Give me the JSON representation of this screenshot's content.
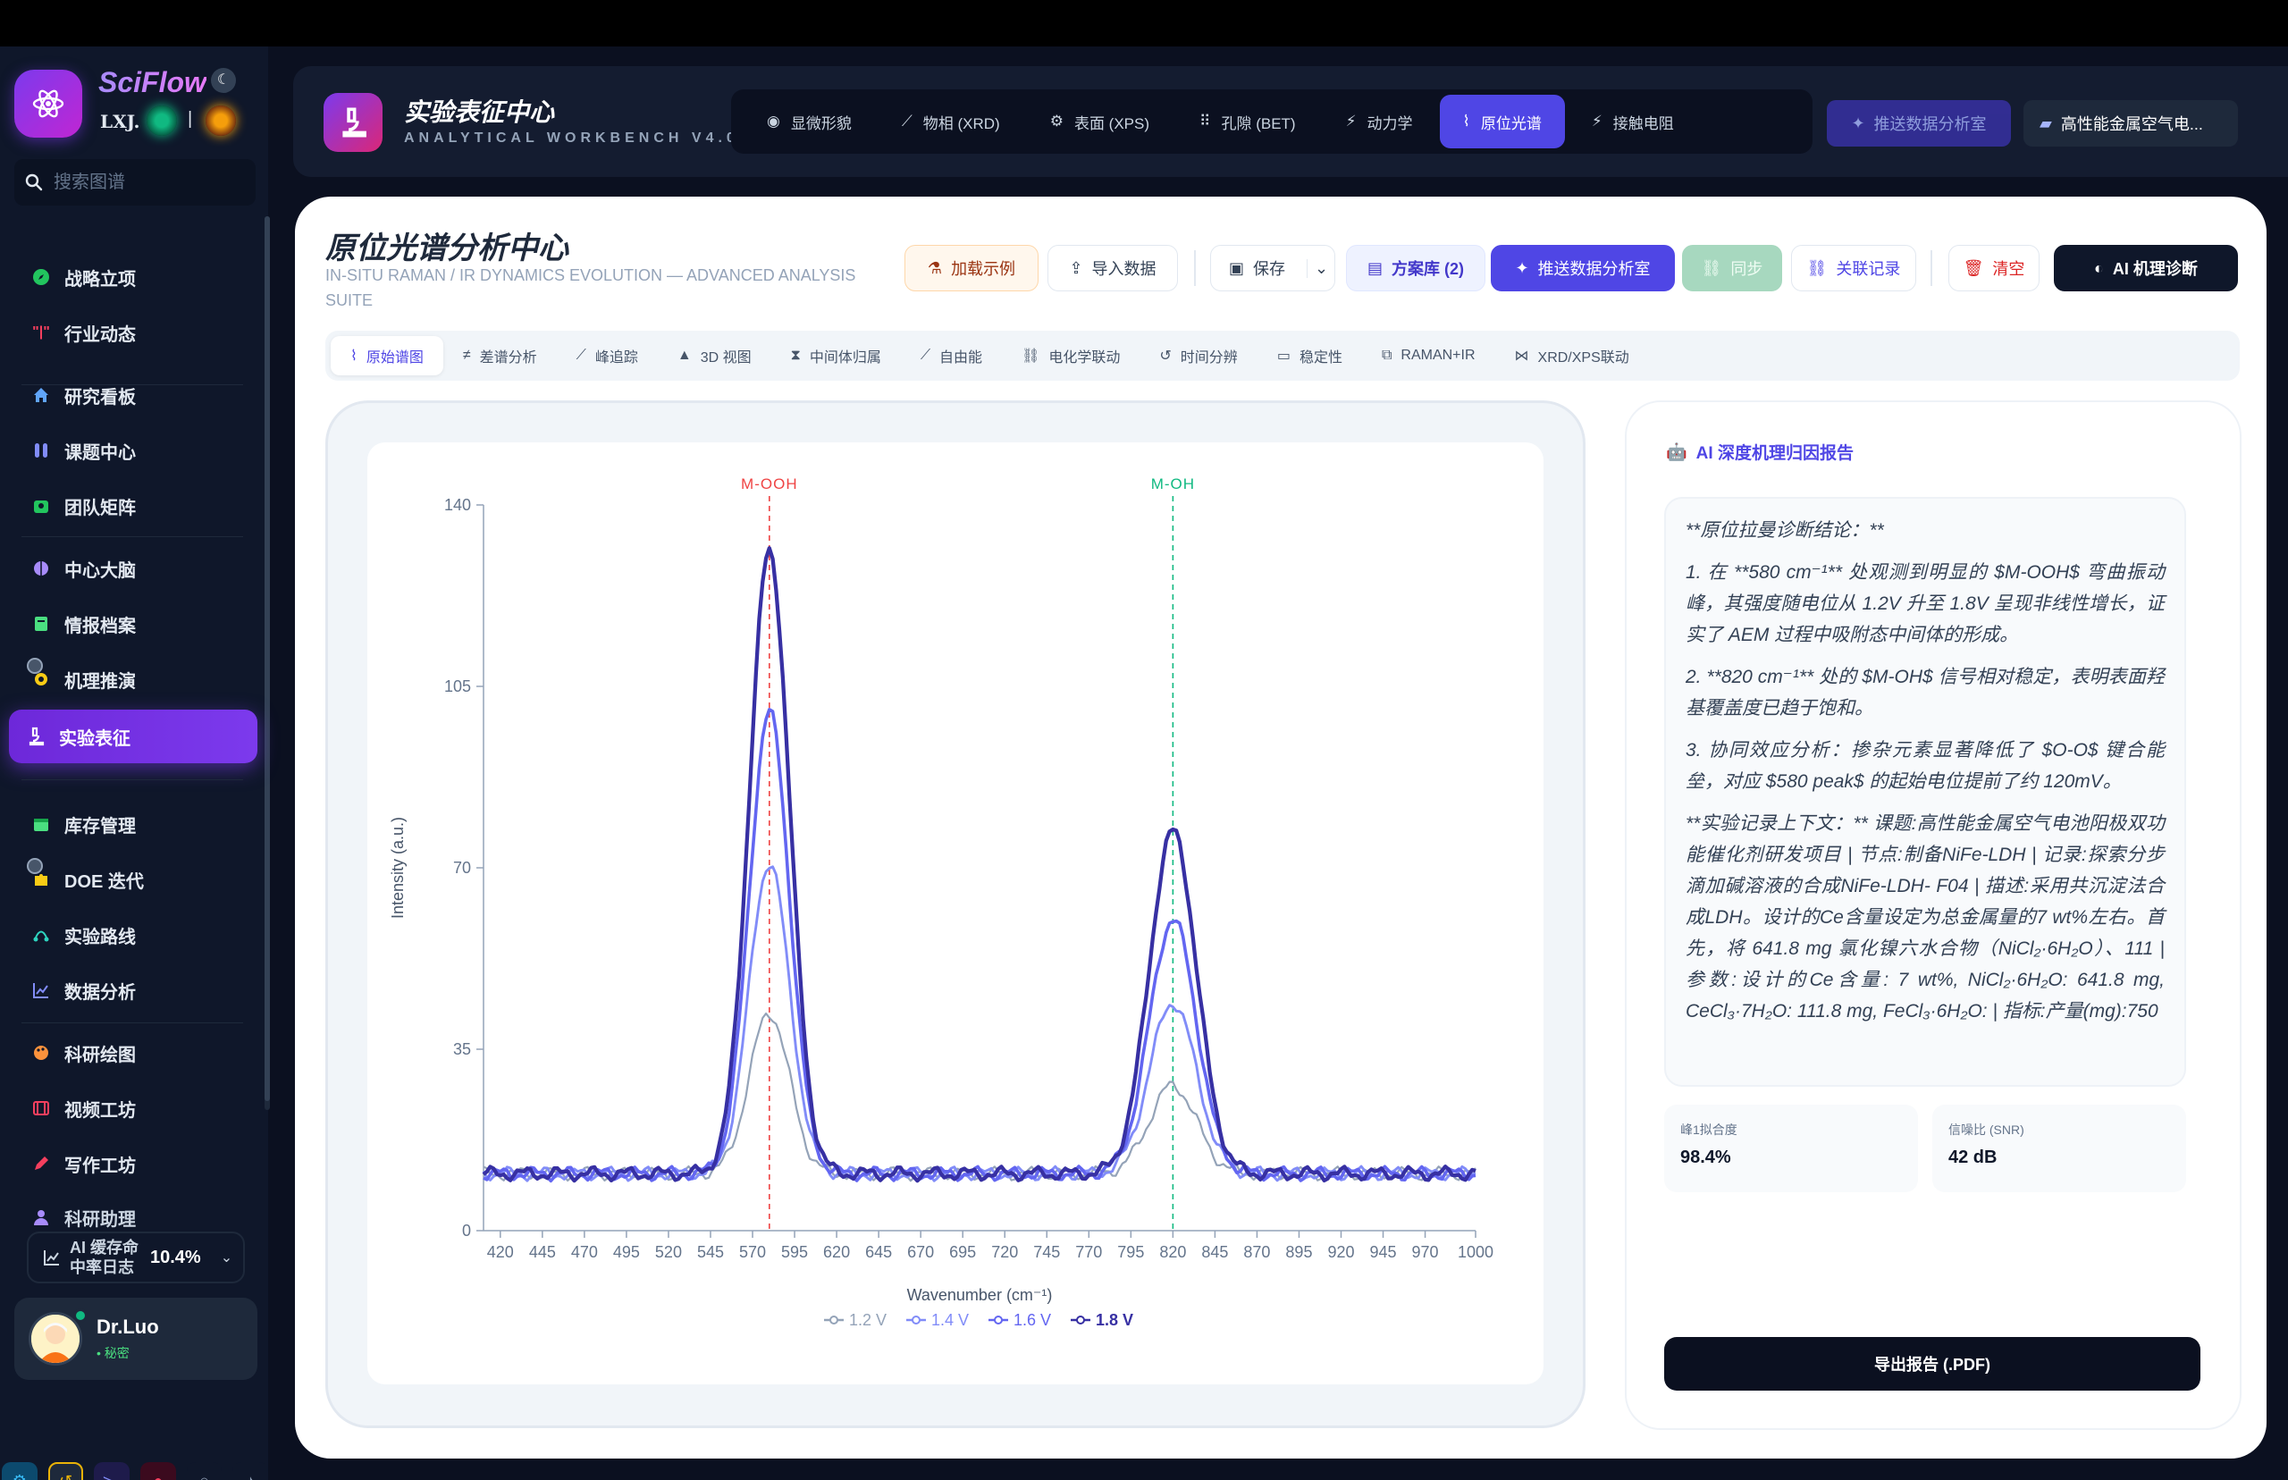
{
  "sidebar": {
    "brand": "SciFlow",
    "brand_sub": "LXJ.",
    "search_placeholder": "搜索图谱",
    "items": [
      {
        "label": "战略立项",
        "icon": "compass-icon"
      },
      {
        "label": "行业动态",
        "icon": "broadcast-icon"
      },
      {
        "label": "研究看板",
        "icon": "home-icon"
      },
      {
        "label": "课题中心",
        "icon": "flask-icon"
      },
      {
        "label": "团队矩阵",
        "icon": "team-icon"
      },
      {
        "label": "中心大脑",
        "icon": "brain-icon"
      },
      {
        "label": "情报档案",
        "icon": "book-icon"
      },
      {
        "label": "机理推演",
        "icon": "gear-icon"
      },
      {
        "label": "实验表征",
        "icon": "microscope-icon"
      },
      {
        "label": "库存管理",
        "icon": "inventory-icon"
      },
      {
        "label": "DOE 迭代",
        "icon": "puzzle-icon"
      },
      {
        "label": "实验路线",
        "icon": "route-icon"
      },
      {
        "label": "数据分析",
        "icon": "chart-icon"
      },
      {
        "label": "科研绘图",
        "icon": "palette-icon"
      },
      {
        "label": "视频工坊",
        "icon": "film-icon"
      },
      {
        "label": "写作工坊",
        "icon": "pen-icon"
      },
      {
        "label": "科研助理",
        "icon": "person-icon"
      }
    ],
    "cache_label": "AI 缓存命中率日志",
    "cache_value": "10.4%",
    "user_name": "Dr.Luo",
    "user_role": "• 秘密"
  },
  "header": {
    "title": "实验表征中心",
    "subtitle": "ANALYTICAL WORKBENCH V4.0",
    "tabs": [
      {
        "label": "显微形貌",
        "icon": "eye-icon"
      },
      {
        "label": "物相 (XRD)",
        "icon": "chart-line-icon"
      },
      {
        "label": "表面 (XPS)",
        "icon": "gear-icon"
      },
      {
        "label": "孔隙 (BET)",
        "icon": "grid-icon"
      },
      {
        "label": "动力学",
        "icon": "bolt-icon"
      },
      {
        "label": "原位光谱",
        "icon": "pulse-icon"
      },
      {
        "label": "接触电阻",
        "icon": "bolt-icon"
      }
    ],
    "push_label": "推送数据分析室",
    "project_label": "高性能金属空气电..."
  },
  "panel": {
    "title": "原位光谱分析中心",
    "subtitle": "IN-SITU RAMAN / IR DYNAMICS EVOLUTION — ADVANCED ANALYSIS SUITE",
    "actions": {
      "demo": "加载示例",
      "import": "导入数据",
      "save": "保存",
      "library": "方案库 (2)",
      "push": "推送数据分析室",
      "sync": "同步",
      "link": "关联记录",
      "clear": "清空",
      "ai": "AI 机理诊断"
    },
    "subtabs": [
      {
        "label": "原始谱图",
        "icon": "pulse-icon"
      },
      {
        "label": "差谱分析",
        "icon": "not-equal-icon"
      },
      {
        "label": "峰追踪",
        "icon": "chart-line-icon"
      },
      {
        "label": "3D 视图",
        "icon": "mountain-icon"
      },
      {
        "label": "中间体归属",
        "icon": "hourglass-icon"
      },
      {
        "label": "自由能",
        "icon": "trend-icon"
      },
      {
        "label": "电化学联动",
        "icon": "link-icon"
      },
      {
        "label": "时间分辨",
        "icon": "history-icon"
      },
      {
        "label": "稳定性",
        "icon": "battery-icon"
      },
      {
        "label": "RAMAN+IR",
        "icon": "merge-icon"
      },
      {
        "label": "XRD/XPS联动",
        "icon": "network-icon"
      }
    ]
  },
  "chart_data": {
    "type": "line",
    "xlabel": "Wavenumber (cm⁻¹)",
    "ylabel": "Intensity (a.u.)",
    "xlim": [
      410,
      1000
    ],
    "ylim": [
      0,
      140
    ],
    "x_ticks": [
      420,
      445,
      470,
      495,
      520,
      545,
      570,
      595,
      620,
      645,
      670,
      695,
      720,
      745,
      770,
      795,
      820,
      845,
      870,
      895,
      920,
      945,
      970,
      1000
    ],
    "y_ticks": [
      0,
      35,
      70,
      105,
      140
    ],
    "legend_position": "bottom",
    "annotations": [
      {
        "label": "M-OOH",
        "x": 580,
        "color": "#ef4444"
      },
      {
        "label": "M-OH",
        "x": 820,
        "color": "#10b981"
      }
    ],
    "series": [
      {
        "name": "1.2 V",
        "color": "#94a3b8",
        "baseline": 11,
        "peaks": [
          {
            "center": 580,
            "height": 42,
            "width": 12
          },
          {
            "center": 820,
            "height": 28,
            "width": 14
          }
        ]
      },
      {
        "name": "1.4 V",
        "color": "#818cf8",
        "baseline": 11,
        "peaks": [
          {
            "center": 580,
            "height": 71,
            "width": 12
          },
          {
            "center": 820,
            "height": 44,
            "width": 14
          }
        ]
      },
      {
        "name": "1.6 V",
        "color": "#6366f1",
        "baseline": 11,
        "peaks": [
          {
            "center": 580,
            "height": 100,
            "width": 12
          },
          {
            "center": 820,
            "height": 60,
            "width": 14
          }
        ]
      },
      {
        "name": "1.8 V",
        "color": "#3730a3",
        "baseline": 11,
        "peaks": [
          {
            "center": 580,
            "height": 131,
            "width": 12
          },
          {
            "center": 820,
            "height": 77,
            "width": 14
          }
        ]
      }
    ]
  },
  "report": {
    "heading": "AI 深度机理归因报告",
    "paragraphs": [
      "**原位拉曼诊断结论：**",
      "1. 在 **580 cm⁻¹** 处观测到明显的 $M-OOH$ 弯曲振动峰，其强度随电位从 1.2V 升至 1.8V 呈现非线性增长，证实了 AEM 过程中吸附态中间体的形成。",
      "2. **820 cm⁻¹** 处的 $M-OH$ 信号相对稳定，表明表面羟基覆盖度已趋于饱和。",
      "3. 协同效应分析：掺杂元素显著降低了 $O-O$ 键合能垒，对应 $580 peak$ 的起始电位提前了约 120mV。",
      "**实验记录上下文：** 课题:高性能金属空气电池阳极双功能催化剂研发项目 | 节点:制备NiFe-LDH | 记录:探索分步滴加碱溶液的合成NiFe-LDH- F04 | 描述:采用共沉淀法合成LDH。设计的Ce含量设定为总金属量的7 wt%左右。首先，将 641.8 mg 氯化镍六水合物（NiCl₂·6H₂O）、111 | 参数:设计的Ce含量: 7 wt%, NiCl₂·6H₂O: 641.8 mg, CeCl₃·7H₂O: 111.8 mg, FeCl₃·6H₂O: | 指标:产量(mg):750"
    ],
    "metrics": [
      {
        "label": "峰1拟合度",
        "value": "98.4%"
      },
      {
        "label": "信噪比 (SNR)",
        "value": "42 dB"
      }
    ],
    "export_label": "导出报告 (.PDF)"
  }
}
